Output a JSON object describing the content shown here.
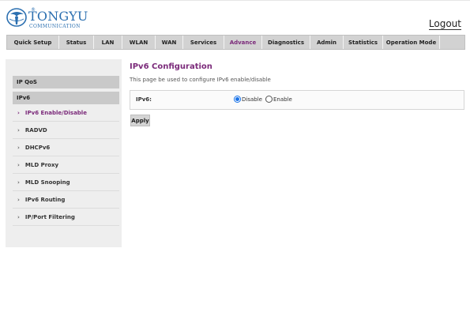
{
  "header": {
    "logo_name": "TONGYU",
    "logo_reg": "®",
    "logo_sub": "COMMUNICATION",
    "logout_label": "Logout",
    "brand_color": "#2b6fb0",
    "accent_color": "#7b2a7a"
  },
  "nav": {
    "items": [
      {
        "label": "Quick Setup"
      },
      {
        "label": "Status"
      },
      {
        "label": "LAN"
      },
      {
        "label": "WLAN"
      },
      {
        "label": "WAN"
      },
      {
        "label": "Services"
      },
      {
        "label": "Advance",
        "active": true
      },
      {
        "label": "Diagnostics"
      },
      {
        "label": "Admin"
      },
      {
        "label": "Statistics"
      },
      {
        "label": "Operation Mode"
      }
    ]
  },
  "sidebar": {
    "groups": [
      {
        "label": "IP QoS"
      },
      {
        "label": "IPv6"
      }
    ],
    "items": [
      {
        "label": "IPv6 Enable/Disable",
        "active": true,
        "icon": "chevron-right-icon"
      },
      {
        "label": "RADVD",
        "icon": "chevron-right-icon"
      },
      {
        "label": "DHCPv6",
        "icon": "chevron-right-icon"
      },
      {
        "label": "MLD Proxy",
        "icon": "chevron-right-icon"
      },
      {
        "label": "MLD Snooping",
        "icon": "chevron-right-icon"
      },
      {
        "label": "IPv6 Routing",
        "icon": "chevron-right-icon"
      },
      {
        "label": "IP/Port Filtering",
        "icon": "chevron-right-icon"
      }
    ]
  },
  "main": {
    "title": "IPv6 Configuration",
    "description": "This page be used to configure IPv6 enable/disable",
    "field_label": "IPv6:",
    "options": [
      {
        "label": "Disable",
        "checked": true
      },
      {
        "label": "Enable",
        "checked": false
      }
    ],
    "apply_label": "Apply"
  }
}
